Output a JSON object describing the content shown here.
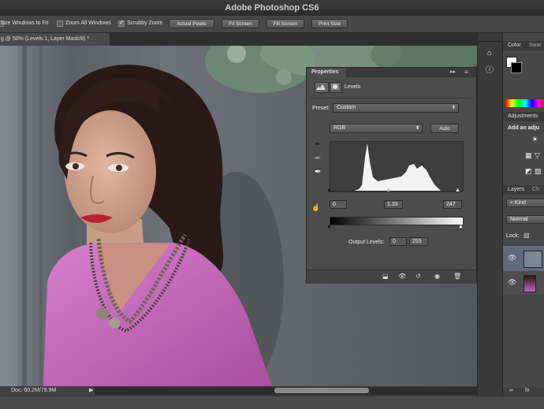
{
  "app": {
    "title": "Adobe Photoshop CS6"
  },
  "options_bar": {
    "resize_windows_label": "size Windows to Fit",
    "zoom_all_label": "Zoom All Windows",
    "scrubby_zoom_label": "Scrubby Zoom",
    "actual_pixels": "Actual Pixels",
    "fit_screen": "Fit Screen",
    "fill_screen": "Fill Screen",
    "print_size": "Print Size"
  },
  "document": {
    "tab_label": "g @ 50% (Levels 1, Layer Mask/8) *",
    "status": "Doc: 60.2M/79.9M"
  },
  "properties": {
    "tab": "Properties",
    "adjustment_name": "Levels",
    "preset_label": "Preset:",
    "preset_value": "Custom",
    "channel_value": "RGB",
    "auto_button": "Auto",
    "input_black": "0",
    "input_gamma": "1.33",
    "input_white": "247",
    "output_label": "Output Levels:",
    "output_black": "0",
    "output_white": "255"
  },
  "dock": {
    "color_tab": "Color",
    "swatches_tab": "Swat",
    "adjustments_title": "Adjustments",
    "add_adjustment_text": "Add an adju",
    "layers_tab": "Layers",
    "channels_tab": "Ch",
    "kind_filter": "Kind",
    "blend_mode": "Normal",
    "lock_label": "Lock:"
  },
  "colors": {
    "ui_dark": "#3a3a3a",
    "panel": "#4c4c4c",
    "shirt": "#c163b8",
    "wall": "#6d6f72"
  },
  "icons": [
    "histogram-icon",
    "mask-icon",
    "eyedropper-icon",
    "hand-target-icon",
    "move-icon",
    "zoom-icon"
  ]
}
